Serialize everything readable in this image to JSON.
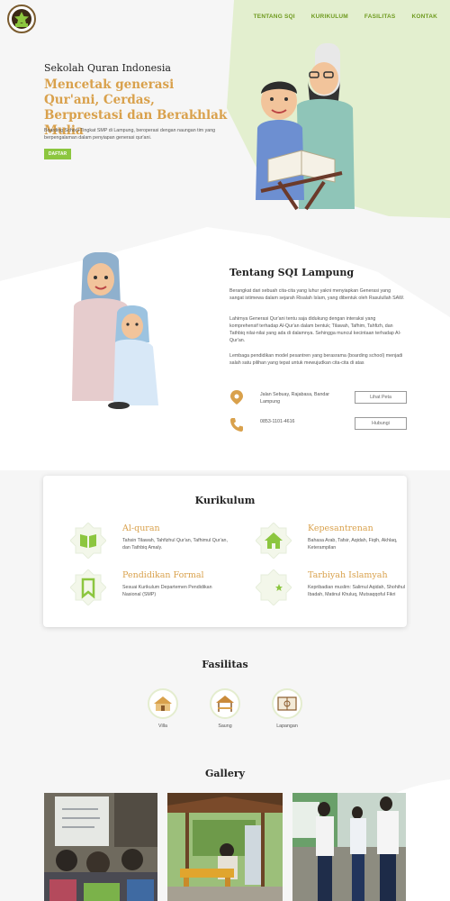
{
  "nav": {
    "logo": "sqi-logo-icon",
    "items": [
      "TENTANG SQI",
      "KURIKULUM",
      "FASILITAS",
      "KONTAK"
    ]
  },
  "hero": {
    "kicker": "Sekolah Quran Indonesia",
    "title": "Mencetak generasi Qur'ani, Cerdas, Berprestasi dan Berakhlak Mulia",
    "desc": "Boarding School Tingkat SMP di Lampung, beroperasi dengan naungan tim yang berpengalaman dalam penyiapan generasi qur'ani.",
    "cta": "DAFTAR"
  },
  "about": {
    "title": "Tentang SQI Lampung",
    "paragraphs": [
      "Berangkat dari sebuah cita-cita yang luhur yakni menyiapkan Generasi yang sangat istimewa dalam sejarah Risalah Islam, yang dibentuk oleh Rasulullah SAW.",
      "Lahirnya Generasi Qur'ani tentu saja didukung dengan interaksi yang komprehensif terhadap Al-Qur'an dalam bentuk; Tilawah, Tafhim, Tahfizh, dan Tathbiq nilai-nilai yang ada di dalamnya. Sehingga muncul kecintaan terhadap Al-Qur'an.",
      "Lembaga pendidikan model pesantren yang berasrama (boarding school) menjadi salah satu pilihan yang tepat untuk mewujudkan cita-cita di atas"
    ],
    "address": "Jalan Sebuay, Rajabasa, Bandar Lampung",
    "phone": "0853-1101-4616",
    "map_button": "Lihat Peta",
    "call_button": "Hubungi"
  },
  "curriculum": {
    "title": "Kurikulum",
    "items": [
      {
        "title": "Al-quran",
        "desc": "Tahsin Tilawah, Tahfizhul Qur'an, Tafhimul Qur'an, dan Tathbiq Amaly.",
        "icon": "book-icon"
      },
      {
        "title": "Kepesantrenan",
        "desc": "Bahasa Arab, Tafsir, Aqidah, Fiqih, Akhlaq, Keterampilan",
        "icon": "home-icon"
      },
      {
        "title": "Pendidikan Formal",
        "desc": "Sesuai Kurikulum Departemen Pendidikan Nasional (SMP)",
        "icon": "bookmark-icon"
      },
      {
        "title": "Tarbiyah Islamyah",
        "desc": "Kepribadian muslim: Salimul Aqidah, Shohihul Ibadah, Matinul Khuluq, Mutsaqqoful Fikri",
        "icon": "crescent-star-icon"
      }
    ]
  },
  "facilities": {
    "title": "Fasilitas",
    "items": [
      {
        "label": "Villa",
        "icon": "villa-icon"
      },
      {
        "label": "Saung",
        "icon": "saung-icon"
      },
      {
        "label": "Lapangan",
        "icon": "field-icon"
      }
    ]
  },
  "gallery": {
    "title": "Gallery"
  },
  "colors": {
    "accent_green": "#8cc63f",
    "gold": "#d9a14c",
    "nav_green": "#6e9a1e"
  }
}
